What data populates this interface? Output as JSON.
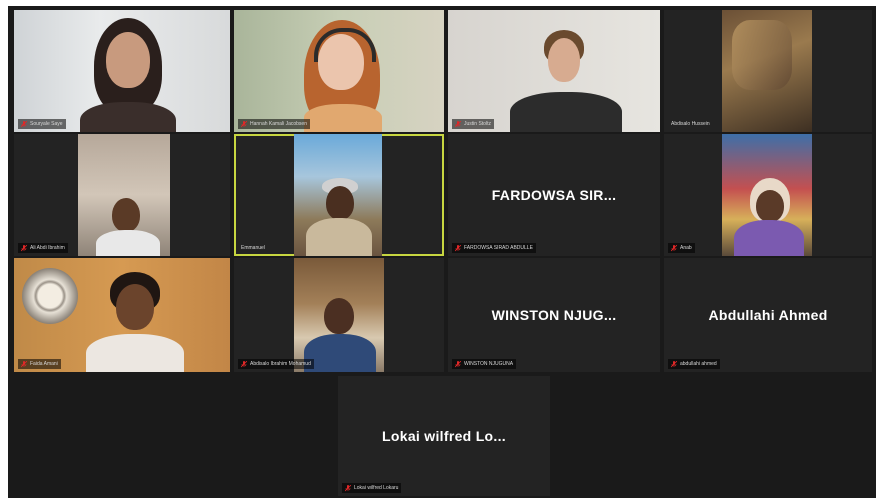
{
  "colors": {
    "background": "#1a1a1a",
    "tile": "#232323",
    "active_speaker_border": "#c7d640",
    "muted_icon": "#e02828"
  },
  "participants": [
    {
      "id": "p1",
      "label": "Souryale Saye",
      "muted": true,
      "video": true
    },
    {
      "id": "p2",
      "label": "Hannah Kamali Jacobsen",
      "muted": true,
      "video": true
    },
    {
      "id": "p3",
      "label": "Justin Stoltz",
      "muted": true,
      "video": true
    },
    {
      "id": "p4",
      "label": "Abdisalo Hussein",
      "muted": false,
      "video": true
    },
    {
      "id": "p5",
      "label": "Ali Abdi Ibrahim",
      "muted": true,
      "video": true
    },
    {
      "id": "p6",
      "label": "Emmanuel",
      "muted": false,
      "video": true,
      "speaking": true
    },
    {
      "id": "p7",
      "display_name": "FARDOWSA SIR...",
      "label": "FARDOWSA SIRAD ABDULLE",
      "muted": true,
      "video": false
    },
    {
      "id": "p8",
      "label": "Anab",
      "muted": true,
      "video": true
    },
    {
      "id": "p9",
      "label": "Faida Amani",
      "muted": true,
      "video": true
    },
    {
      "id": "p10",
      "label": "Abdisalo Ibrahim Mohamud",
      "muted": true,
      "video": true
    },
    {
      "id": "p11",
      "display_name": "WINSTON NJUG...",
      "label": "WINSTON NJUGUNA",
      "muted": true,
      "video": false
    },
    {
      "id": "p12",
      "display_name": "Abdullahi Ahmed",
      "label": "abdullahi ahmed",
      "muted": true,
      "video": false
    },
    {
      "id": "p13",
      "display_name": "Lokai wilfred Lo...",
      "label": "Lokai wilfred Lokaru",
      "muted": true,
      "video": false
    }
  ]
}
